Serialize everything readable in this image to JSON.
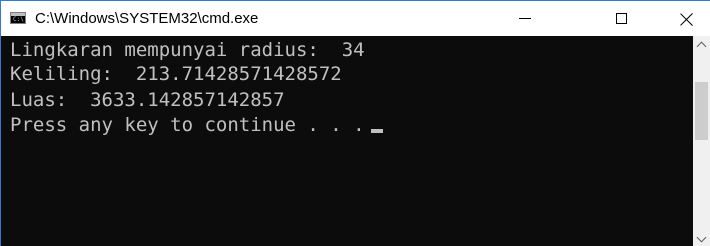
{
  "window": {
    "title": "C:\\Windows\\SYSTEM32\\cmd.exe",
    "icon": "cmd-icon",
    "icon_text": "C:\\",
    "controls": {
      "minimize": "minimize-icon",
      "maximize": "maximize-icon",
      "close": "close-icon"
    }
  },
  "console": {
    "lines": [
      "Lingkaran mempunyai radius:  34",
      "Keliling:  213.71428571428572",
      "Luas:  3633.142857142857",
      "Press any key to continue . . ."
    ],
    "colors": {
      "background": "#0c0c0c",
      "text": "#c0c0c0"
    }
  },
  "colors": {
    "window_border": "#2b7cd3",
    "titlebar": "#ffffff",
    "scrollbar_track": "#f0f0f0",
    "scrollbar_thumb": "#cdcdcd"
  }
}
